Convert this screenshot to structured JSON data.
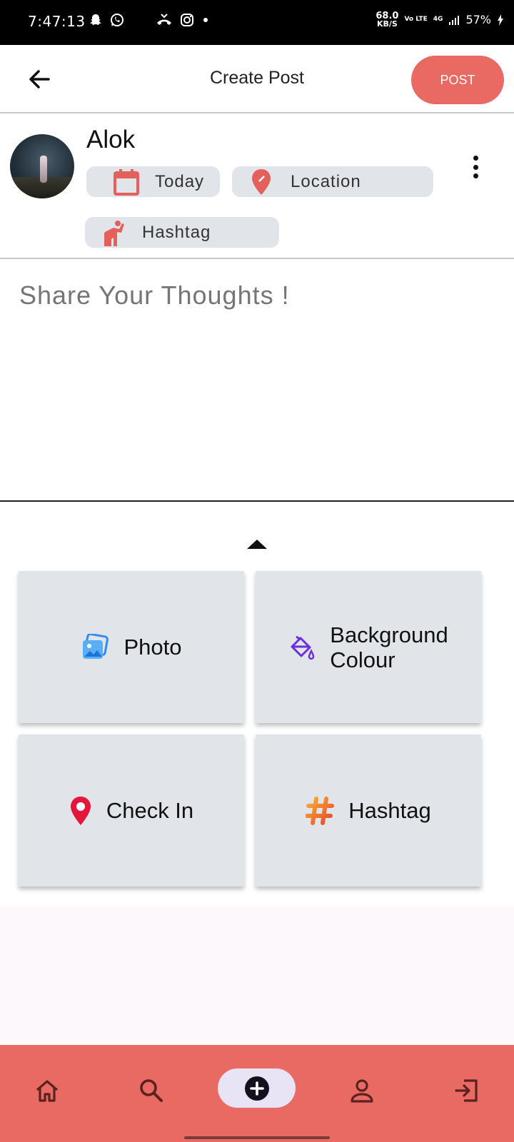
{
  "status_bar": {
    "time": "7:47:13",
    "net_speed": "68.0",
    "net_unit": "KB/S",
    "volte": "Vo LTE",
    "network": "4G",
    "battery": "57%"
  },
  "app_bar": {
    "title": "Create Post",
    "post_label": "POST"
  },
  "user": {
    "name": "Alok"
  },
  "chips": {
    "date": "Today",
    "location": "Location",
    "hashtag": "Hashtag"
  },
  "composer": {
    "placeholder": "Share Your Thoughts !"
  },
  "options": [
    {
      "label": "Photo",
      "icon": "photo-icon",
      "color": "#2f8ff0"
    },
    {
      "label_line1": "Background",
      "label_line2": "Colour",
      "icon": "paint-bucket-icon",
      "color": "#6a2fd8"
    },
    {
      "label": "Check In",
      "icon": "map-pin-icon",
      "color": "#e3163c"
    },
    {
      "label": "Hashtag",
      "icon": "hashtag-icon",
      "color": "#f5821f"
    }
  ],
  "bottom_nav": [
    {
      "icon": "home-icon"
    },
    {
      "icon": "search-icon"
    },
    {
      "icon": "add-circle-icon",
      "active": true
    },
    {
      "icon": "person-icon"
    },
    {
      "icon": "logout-icon"
    }
  ],
  "colors": {
    "accent": "#e86a62",
    "chip_bg": "#e1e4e8",
    "tile_bg": "#e1e4e8"
  }
}
